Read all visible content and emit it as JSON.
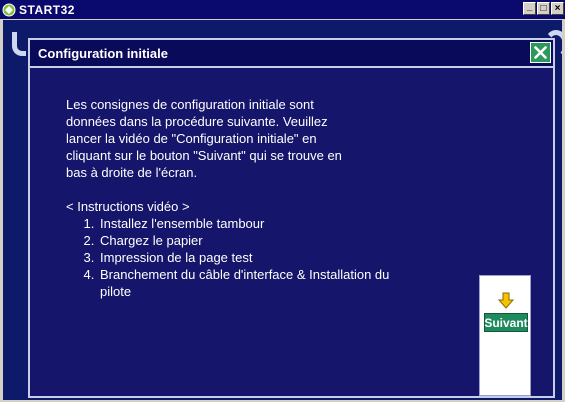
{
  "window": {
    "title": "START32",
    "controls": {
      "minimize": "_",
      "maximize": "□",
      "close": "×"
    }
  },
  "dialog": {
    "title": "Configuration initiale",
    "close_icon": "close-icon",
    "intro": [
      "Les consignes de configuration initiale sont",
      "données dans la procédure suivante. Veuillez",
      "lancer la vidéo de \"Configuration initiale\" en",
      "cliquant sur le bouton \"Suivant\" qui se trouve en",
      "bas à droite de l'écran."
    ],
    "section_heading": "< Instructions vidéo >",
    "steps": [
      "Installez l'ensemble tambour",
      "Chargez le papier",
      "Impression de la page test",
      "Branchement du câble d'interface & Installation du pilote"
    ]
  },
  "next": {
    "label": "Suivant",
    "arrow_icon": "arrow-down-icon"
  },
  "colors": {
    "dialog_bg": "#15156b",
    "accent_green": "#1e8a5e",
    "arrow_yellow": "#f5c400"
  }
}
